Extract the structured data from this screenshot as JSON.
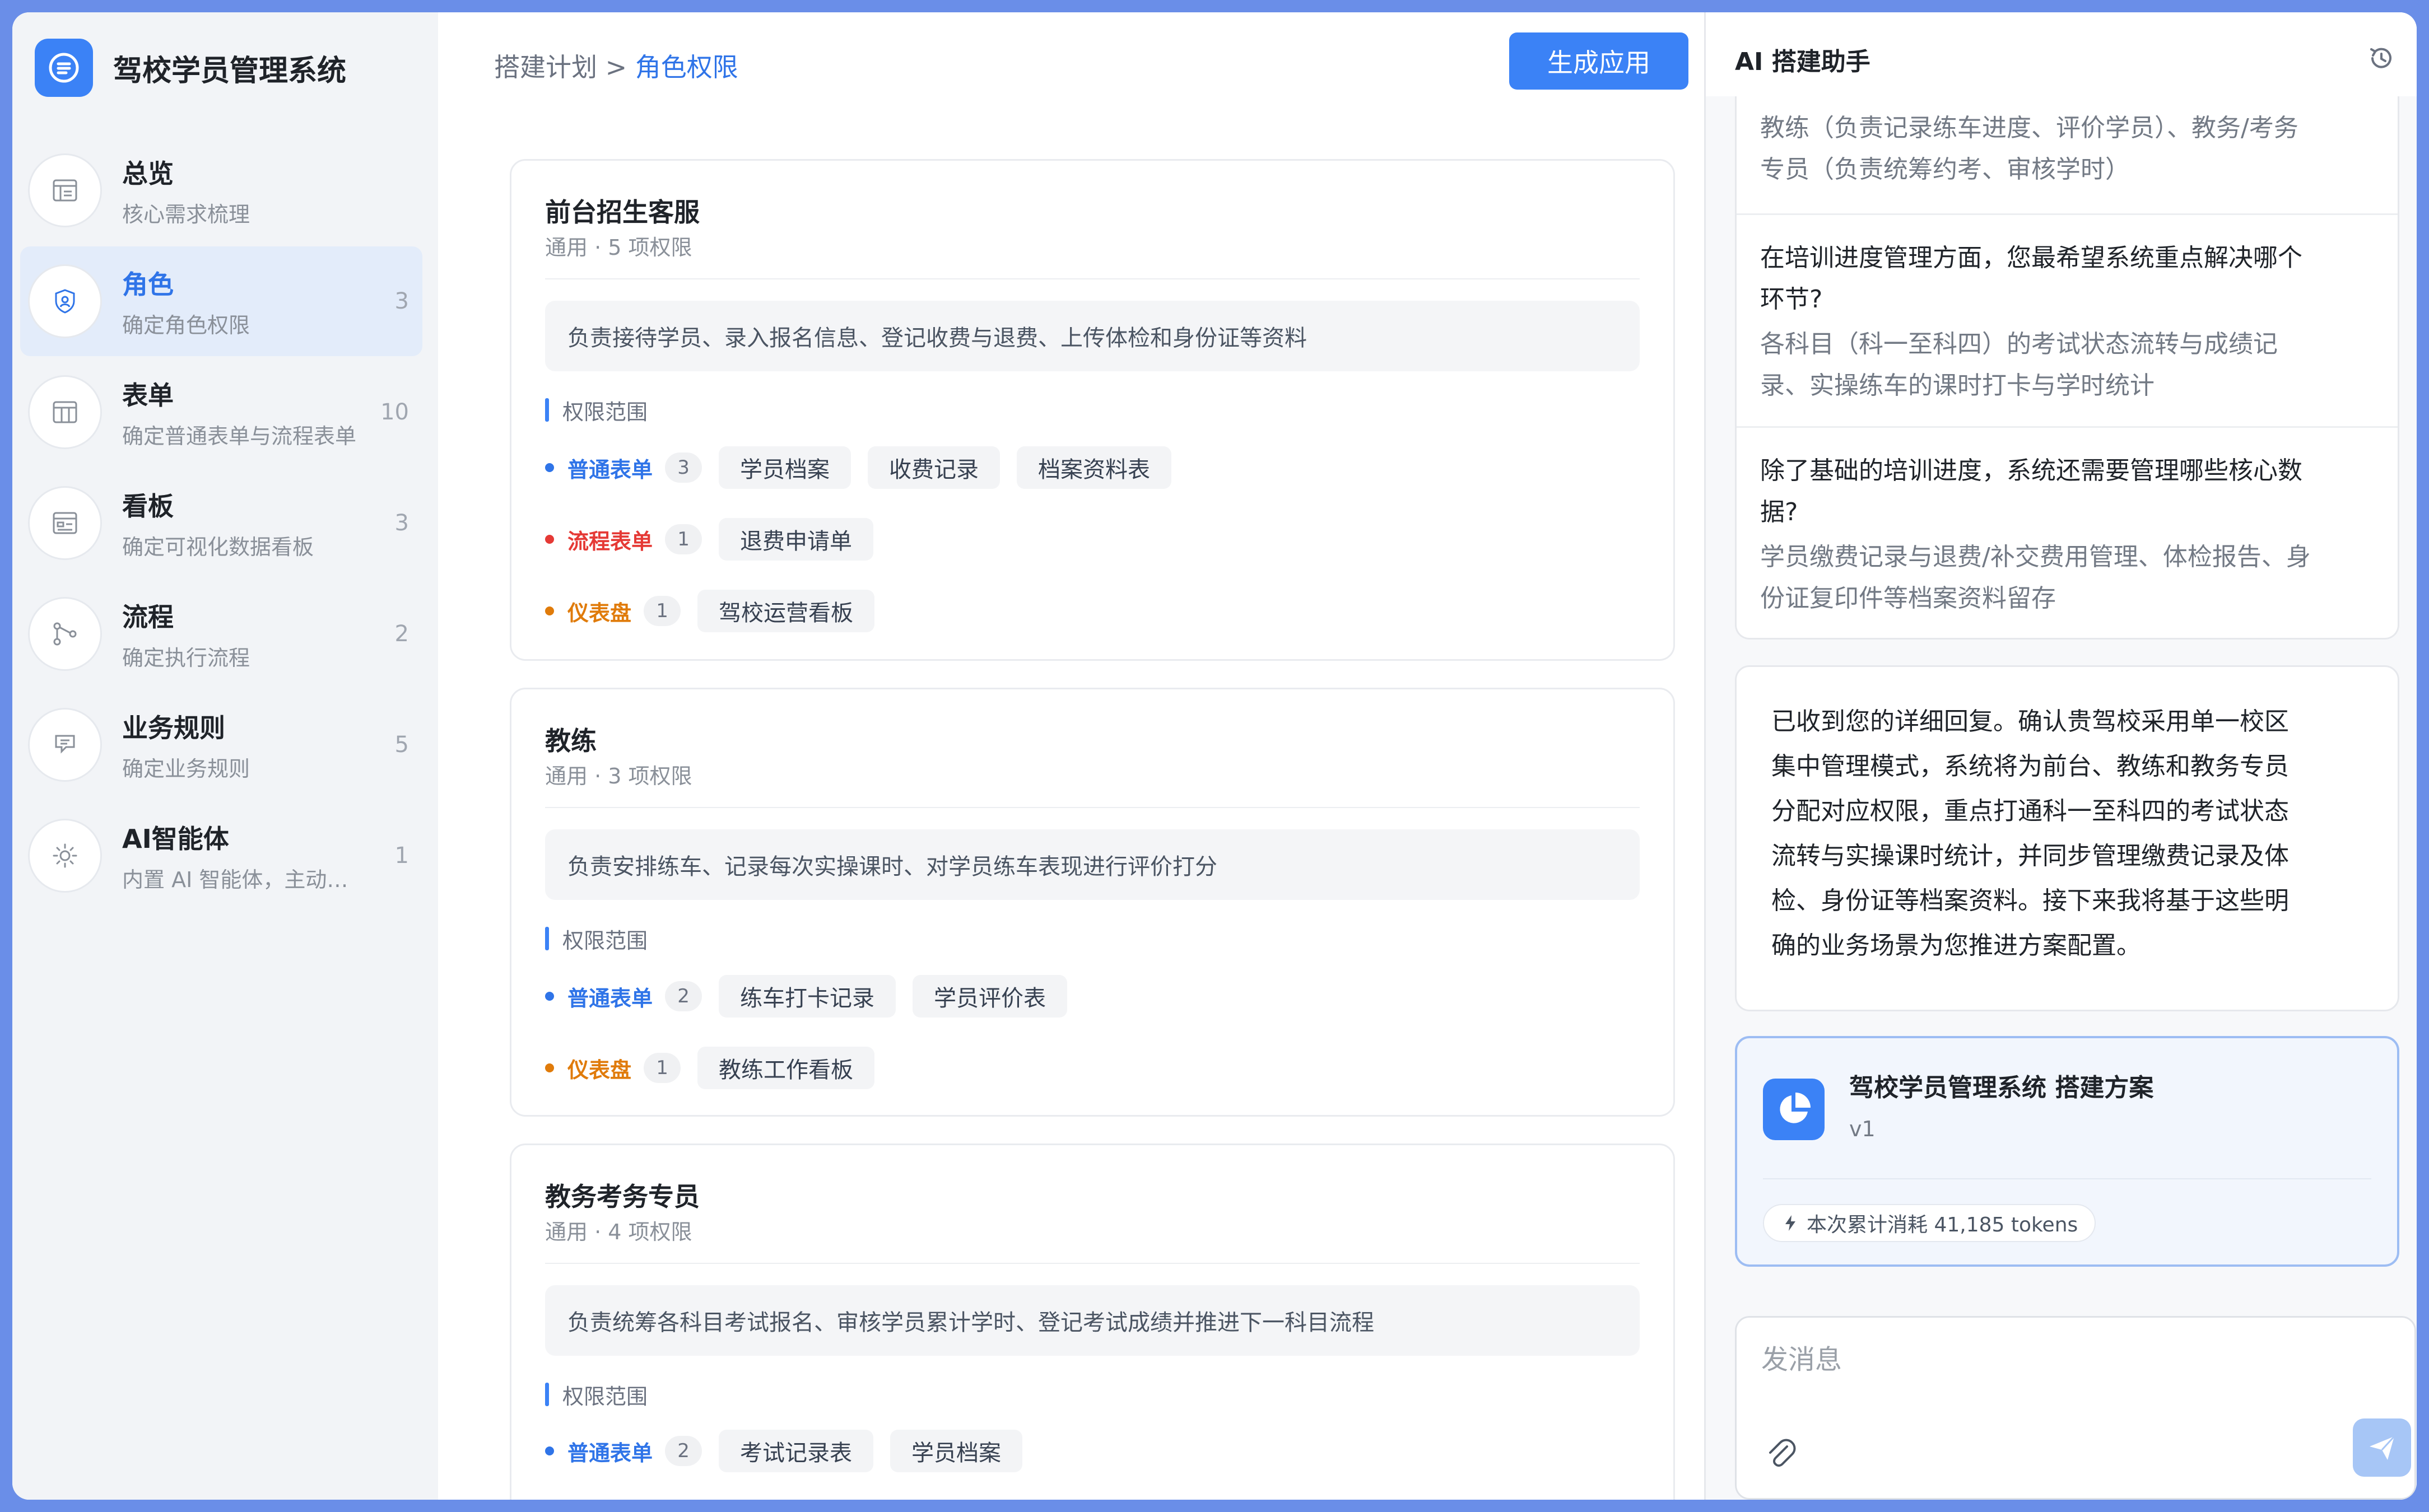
{
  "app": {
    "name": "驾校学员管理系统"
  },
  "sidebar": {
    "items": [
      {
        "title": "总览",
        "sub": "核心需求梳理",
        "count": "",
        "icon": "overview-icon"
      },
      {
        "title": "角色",
        "sub": "确定角色权限",
        "count": "3",
        "icon": "role-shield-icon"
      },
      {
        "title": "表单",
        "sub": "确定普通表单与流程表单",
        "count": "10",
        "icon": "table-icon"
      },
      {
        "title": "看板",
        "sub": "确定可视化数据看板",
        "count": "3",
        "icon": "dashboard-icon"
      },
      {
        "title": "流程",
        "sub": "确定执行流程",
        "count": "2",
        "icon": "flow-icon"
      },
      {
        "title": "业务规则",
        "sub": "确定业务规则",
        "count": "5",
        "icon": "rule-icon"
      },
      {
        "title": "AI智能体",
        "sub": "内置 AI 智能体，主动执行任务",
        "count": "1",
        "icon": "ai-agent-icon"
      }
    ]
  },
  "header": {
    "breadcrumb_parent": "搭建计划 >",
    "breadcrumb_current": "角色权限",
    "generate_label": "生成应用"
  },
  "scope_label": "权限范围",
  "perm_colors": {
    "form": "#2f74e8",
    "flow": "#e53935",
    "dash": "#e07b0a"
  },
  "roles": [
    {
      "title": "前台招生客服",
      "meta": "通用 · 5 项权限",
      "desc": "负责接待学员、录入报名信息、登记收费与退费、上传体检和身份证等资料",
      "perms": [
        {
          "type": "普通表单",
          "kind": "form",
          "count": "3",
          "items": [
            "学员档案",
            "收费记录",
            "档案资料表"
          ]
        },
        {
          "type": "流程表单",
          "kind": "flow",
          "count": "1",
          "items": [
            "退费申请单"
          ]
        },
        {
          "type": "仪表盘",
          "kind": "dash",
          "count": "1",
          "items": [
            "驾校运营看板"
          ]
        }
      ]
    },
    {
      "title": "教练",
      "meta": "通用 · 3 项权限",
      "desc": "负责安排练车、记录每次实操课时、对学员练车表现进行评价打分",
      "perms": [
        {
          "type": "普通表单",
          "kind": "form",
          "count": "2",
          "items": [
            "练车打卡记录",
            "学员评价表"
          ]
        },
        {
          "type": "仪表盘",
          "kind": "dash",
          "count": "1",
          "items": [
            "教练工作看板"
          ]
        }
      ]
    },
    {
      "title": "教务考务专员",
      "meta": "通用 · 4 项权限",
      "desc": "负责统筹各科目考试报名、审核学员累计学时、登记考试成绩并推进下一科目流程",
      "perms": [
        {
          "type": "普通表单",
          "kind": "form",
          "count": "2",
          "items": [
            "考试记录表",
            "学员档案"
          ]
        }
      ]
    }
  ],
  "assistant": {
    "title": "AI 搭建助手",
    "qa": [
      {
        "a_line1": "教练（负责记录练车进度、评价学员）、教务/考务",
        "a_line2": "专员（负责统筹约考、审核学时）"
      },
      {
        "q_line1": "在培训进度管理方面，您最希望系统重点解决哪个",
        "q_line2": "环节?",
        "a_line1": "各科目（科一至科四）的考试状态流转与成绩记",
        "a_line2": "录、实操练车的课时打卡与学时统计"
      },
      {
        "q_line1": "除了基础的培训进度，系统还需要管理哪些核心数",
        "q_line2": "据?",
        "a_line1": "学员缴费记录与退费/补交费用管理、体检报告、身",
        "a_line2": "份证复印件等档案资料留存"
      }
    ],
    "reply_lines": [
      "已收到您的详细回复。确认贵驾校采用单一校区",
      "集中管理模式，系统将为前台、教练和教务专员",
      "分配对应权限，重点打通科一至科四的考试状态",
      "流转与实操课时统计，并同步管理缴费记录及体",
      "检、身份证等档案资料。接下来我将基于这些明",
      "确的业务场景为您推进方案配置。"
    ],
    "plan": {
      "title": "驾校学员管理系统  搭建方案",
      "version": "v1",
      "tokens": "本次累计消耗 41,185 tokens"
    },
    "composer_placeholder": "发消息"
  }
}
